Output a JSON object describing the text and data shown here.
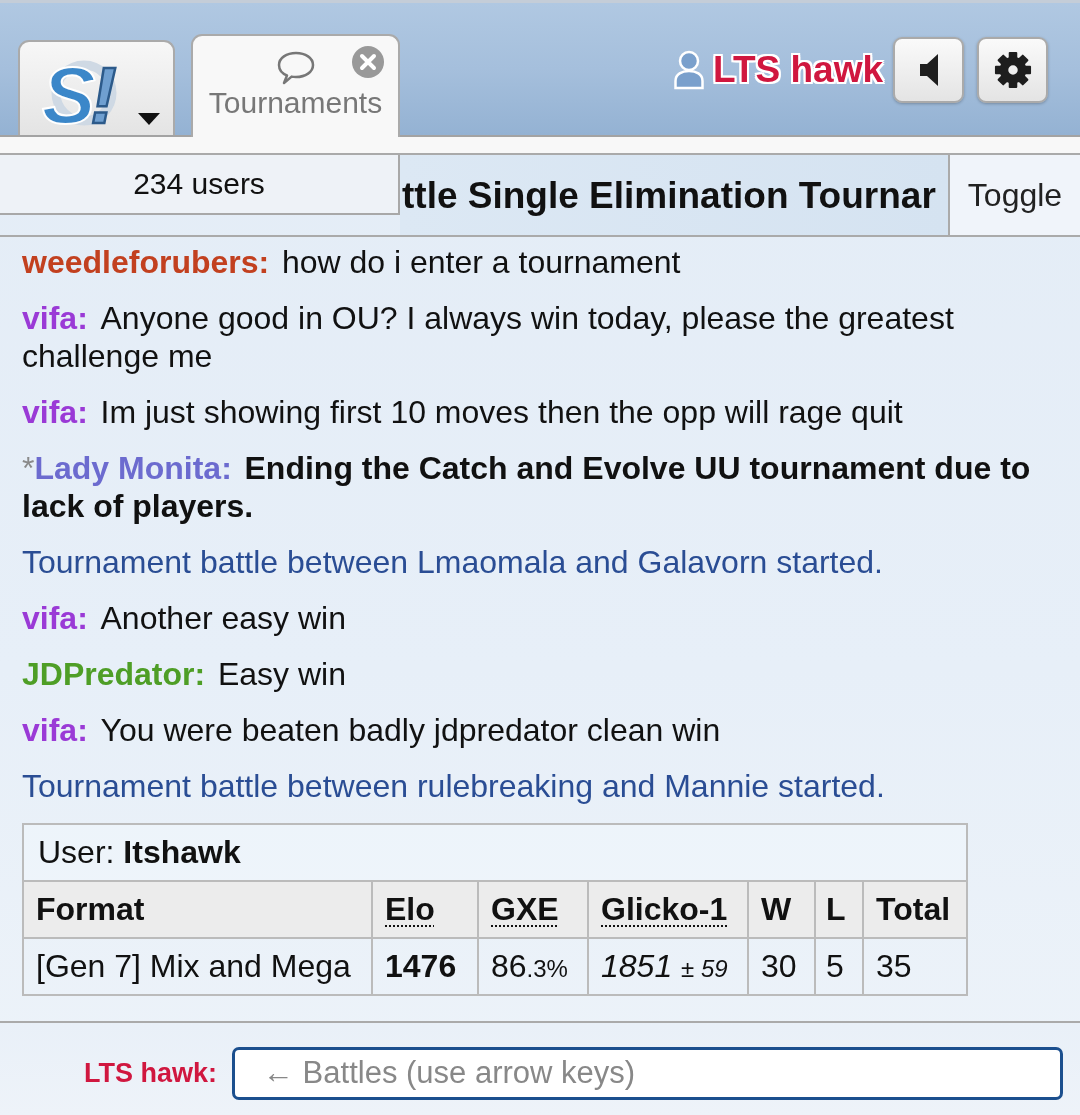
{
  "header": {
    "tabs": [
      {
        "kind": "home",
        "logo": {
          "letter": "S",
          "mark": "!"
        },
        "selected": false
      },
      {
        "kind": "room",
        "label": "Tournaments",
        "closable": true,
        "selected": true
      }
    ],
    "user": {
      "name": "LTS hawk"
    },
    "buttons": [
      {
        "kind": "volume"
      },
      {
        "kind": "settings"
      }
    ]
  },
  "room": {
    "user_count": "234 users",
    "title": "ttle Single Elimination Tournar",
    "toggle": "Toggle"
  },
  "messages": [
    {
      "kind": "chat",
      "name": "weedleforubers:",
      "color": "#c2401f",
      "bold": false,
      "text": "how do i enter a tournament"
    },
    {
      "kind": "chat",
      "name": "vifa:",
      "color": "#9a3ad6",
      "bold": false,
      "text": "Anyone good in OU? I always win today, please the greatest challenge me"
    },
    {
      "kind": "chat",
      "name": "vifa:",
      "color": "#9a3ad6",
      "bold": false,
      "text": "Im just showing first 10 moves then the opp will rage quit"
    },
    {
      "kind": "chat",
      "group": "*",
      "name": "Lady Monita:",
      "color": "#6c6bcf",
      "bold": true,
      "text": "Ending the Catch and Evolve UU tournament due to lack of players."
    },
    {
      "kind": "notice",
      "text": "Tournament battle between Lmaomala and Galavorn started."
    },
    {
      "kind": "chat",
      "name": "vifa:",
      "color": "#9a3ad6",
      "bold": false,
      "text": "Another easy win"
    },
    {
      "kind": "chat",
      "name": "JDPredator:",
      "color": "#4e9e26",
      "bold": false,
      "text": "Easy win"
    },
    {
      "kind": "chat",
      "name": "vifa:",
      "color": "#9a3ad6",
      "bold": false,
      "text": "You were beaten badly jdpredator clean win"
    },
    {
      "kind": "notice",
      "text": "Tournament battle between rulebreaking and Mannie started."
    }
  ],
  "ranking": {
    "user": "User: **Itshawk**",
    "columns": [
      {
        "label": "Format",
        "abbr": false
      },
      {
        "label": "Elo",
        "abbr": true
      },
      {
        "label": "GXE",
        "abbr": true
      },
      {
        "label": "Glicko-1",
        "abbr": true
      },
      {
        "label": "W",
        "abbr": false
      },
      {
        "label": "L",
        "abbr": false
      },
      {
        "label": "Total",
        "abbr": false
      }
    ],
    "rows": [
      [
        {
          "kind": "text",
          "text": "[Gen 7] Mix and Mega"
        },
        {
          "kind": "strong",
          "text": "1476"
        },
        {
          "kind": "percent",
          "whole": "86",
          "fraction": ".3%"
        },
        {
          "kind": "rating",
          "rating": "1851",
          "deviation": "± 59"
        },
        {
          "kind": "text",
          "text": "30"
        },
        {
          "kind": "text",
          "text": "5"
        },
        {
          "kind": "text",
          "text": "35"
        }
      ]
    ]
  },
  "composer": {
    "label": "LTS hawk:",
    "placeholder": "← Battles (use arrow keys)"
  }
}
